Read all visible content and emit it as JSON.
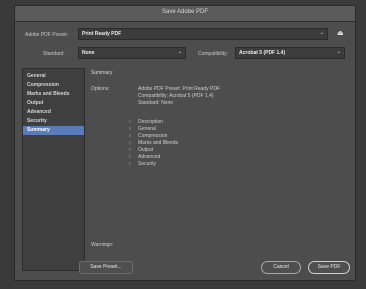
{
  "window": {
    "title": "Save Adobe PDF"
  },
  "preset": {
    "label": "Adobe PDF Preset:",
    "value": "Print Ready PDF"
  },
  "standard": {
    "label": "Standard:",
    "value": "None"
  },
  "compatibility": {
    "label": "Compatibility:",
    "value": "Acrobat 5 (PDF 1.4)"
  },
  "sidebar": {
    "items": [
      {
        "label": "General",
        "selected": false
      },
      {
        "label": "Compression",
        "selected": false
      },
      {
        "label": "Marks and Bleeds",
        "selected": false
      },
      {
        "label": "Output",
        "selected": false
      },
      {
        "label": "Advanced",
        "selected": false
      },
      {
        "label": "Security",
        "selected": false
      },
      {
        "label": "Summary",
        "selected": true
      }
    ]
  },
  "summary": {
    "heading": "Summary",
    "options_label": "Options:",
    "lines": [
      "Adobe PDF Preset: Print Ready PDF",
      "Compatibility: Acrobat 5 (PDF 1.4)",
      "Standard: None"
    ],
    "sections": [
      "Description",
      "General",
      "Compression",
      "Marks and Bleeds",
      "Output",
      "Advanced",
      "Security"
    ],
    "warnings_label": "Warnings:"
  },
  "buttons": {
    "save_preset": "Save Preset...",
    "cancel": "Cancel",
    "save_pdf": "Save PDF"
  }
}
